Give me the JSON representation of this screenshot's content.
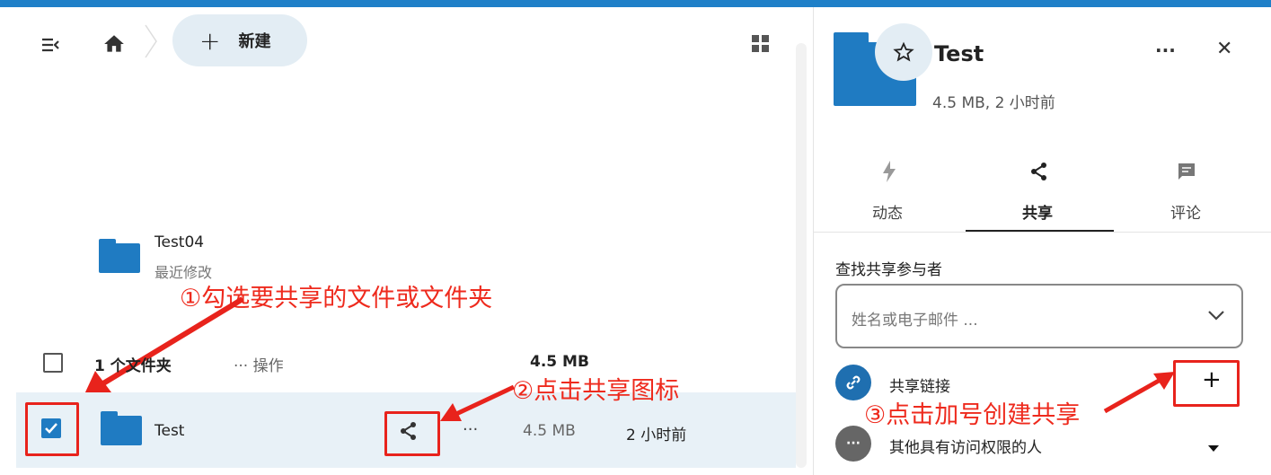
{
  "toolbar": {
    "new_button_label": "新建",
    "new_button_plus": "+"
  },
  "recent": {
    "name": "Test04",
    "subtitle": "最近修改"
  },
  "list_header": {
    "count_label": "1 个文件夹",
    "actions_label": "··· 操作",
    "total_size": "4.5 MB"
  },
  "file_row": {
    "name": "Test",
    "more": "···",
    "size": "4.5 MB",
    "modified": "2 小时前"
  },
  "annotations": {
    "step1": "①勾选要共享的文件或文件夹",
    "step2": "②点击共享图标",
    "step3": "③点击加号创建共享"
  },
  "sidebar": {
    "title": "Test",
    "meta": "4.5 MB, 2 小时前",
    "more": "···",
    "close": "✕",
    "tabs": [
      {
        "label": "动态",
        "icon": "lightning-icon"
      },
      {
        "label": "共享",
        "icon": "share-icon"
      },
      {
        "label": "评论",
        "icon": "comment-icon"
      }
    ],
    "search_label": "查找共享参与者",
    "search_placeholder": "姓名或电子邮件 ...",
    "share_link_label": "共享链接",
    "add_symbol": "+",
    "others_label": "其他具有访问权限的人",
    "others_avatar": "···"
  },
  "colors": {
    "accent": "#1f7bc2",
    "annotation": "#e8231c",
    "selected_row": "#e8f1f7"
  }
}
